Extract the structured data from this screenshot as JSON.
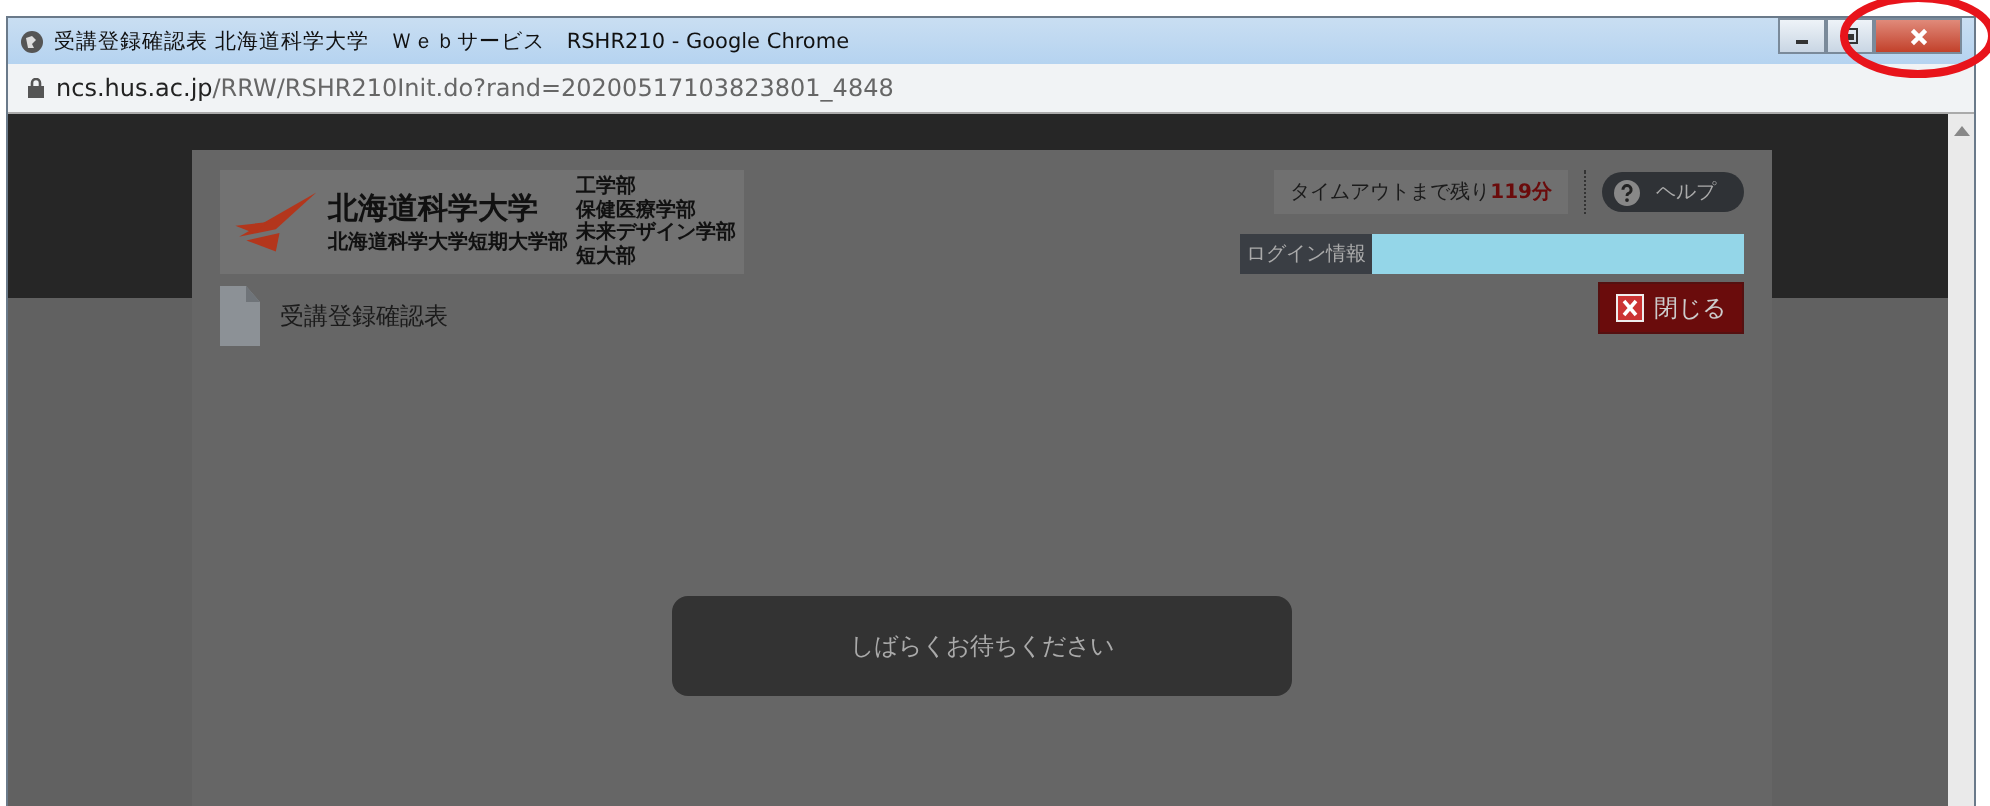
{
  "window": {
    "title": "受講登録確認表 北海道科学大学　Ｗｅｂサービス　RSHR210 - Google Chrome",
    "url_host": "ncs.hus.ac.jp",
    "url_path": "/RRW/RSHR210Init.do?rand=20200517103823801_4848"
  },
  "header": {
    "logo": {
      "main": "北海道科学大学",
      "sub": "北海道科学大学短期大学部",
      "faculties": [
        "工学部",
        "保健医療学部",
        "未来デザイン学部",
        "短大部"
      ]
    },
    "timeout": {
      "label": "タイムアウトまで残り",
      "value": "119分"
    },
    "help_button": "ヘルプ",
    "login_label": "ログイン情報"
  },
  "page": {
    "title": "受講登録確認表",
    "close_button": "閉じる"
  },
  "loading": {
    "message": "しばらくお待ちください"
  }
}
